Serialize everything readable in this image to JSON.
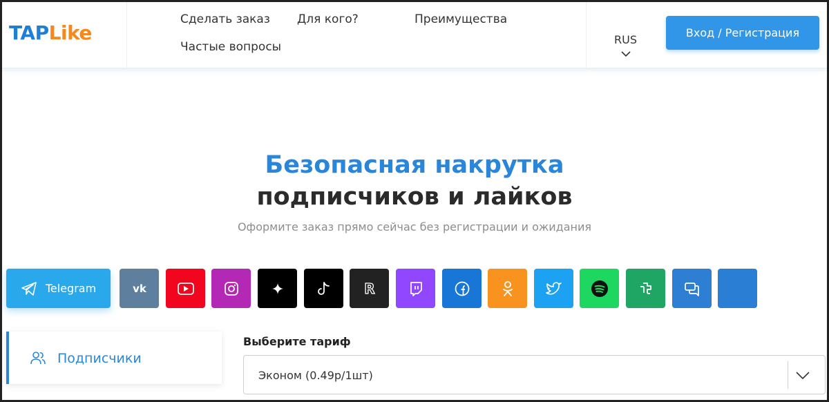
{
  "logo": {
    "part1": "TAP",
    "part2": "Like"
  },
  "nav": {
    "order": "Сделать заказ",
    "for_whom": "Для кого?",
    "advantages": "Преимущества",
    "faq": "Частые вопросы"
  },
  "language": {
    "current": "RUS"
  },
  "login_button": "Вход / Регистрация",
  "hero": {
    "title_line1": "Безопасная накрутка",
    "title_line2": "подписчиков и лайков",
    "subtitle": "Оформите заказ прямо сейчас без регистрации и ожидания"
  },
  "platforms": [
    {
      "id": "telegram",
      "label": "Telegram",
      "icon": "telegram-icon",
      "color": "#29a9eb",
      "active": true
    },
    {
      "id": "vk",
      "icon": "vk-icon",
      "color": "#5f7f9f"
    },
    {
      "id": "youtube",
      "icon": "youtube-icon",
      "color": "#f2061f"
    },
    {
      "id": "instagram",
      "icon": "instagram-icon",
      "color": "#b328b5"
    },
    {
      "id": "threads",
      "icon": "sparkle-icon",
      "color": "#000000"
    },
    {
      "id": "tiktok",
      "icon": "tiktok-icon",
      "color": "#000000"
    },
    {
      "id": "rutube",
      "icon": "rutube-icon",
      "color": "#222222"
    },
    {
      "id": "twitch",
      "icon": "twitch-icon",
      "color": "#9147ff"
    },
    {
      "id": "facebook",
      "icon": "facebook-icon",
      "color": "#1877d6"
    },
    {
      "id": "odnoklassniki",
      "icon": "ok-icon",
      "color": "#f7931e"
    },
    {
      "id": "twitter",
      "icon": "twitter-icon",
      "color": "#1da1f2"
    },
    {
      "id": "spotify",
      "icon": "spotify-icon",
      "color": "#1ed760"
    },
    {
      "id": "tumblr",
      "icon": "tumblr-icon",
      "color": "#1fa564"
    },
    {
      "id": "chat",
      "icon": "chat-icon",
      "color": "#2e7fd4"
    },
    {
      "id": "more",
      "icon": "blank-icon",
      "color": "#2a7fd5"
    }
  ],
  "service": {
    "label": "Подписчики",
    "icon": "users-icon"
  },
  "tariff": {
    "label": "Выберите тариф",
    "selected": "Эконом (0.49р/1шт)"
  },
  "colors": {
    "accent": "#2a86d9",
    "brand_orange": "#f5891f",
    "button": "#3196e8"
  }
}
